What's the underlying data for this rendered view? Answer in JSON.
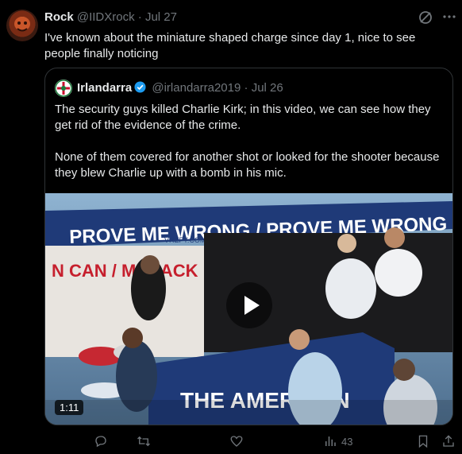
{
  "tweet": {
    "author_name": "Rock",
    "author_handle": "@IIDXrock",
    "separator": "·",
    "date": "Jul 27",
    "text": "I've known about the miniature shaped charge since day 1, nice to see people finally noticing"
  },
  "quote": {
    "author_name": "Irlandarra",
    "author_handle": "@irlandarra2019",
    "separator": "·",
    "date": "Jul 26",
    "paragraph1": "The security guys  killed Charlie Kirk; in this video, we can see how they get rid of the evidence of the crime.",
    "paragraph2": "None of them covered for another shot or looked for the shooter because they blew Charlie up with a bomb in his mic.",
    "video": {
      "banner_text": "PROVE ME WRONG / PROVE ME WRONG",
      "left_sign": "N CAN / MEBACK",
      "site_text": "VREFY.COM",
      "table_sign": "THE AMERICAN",
      "duration": "1:11"
    }
  },
  "actions": {
    "views_count": "43"
  },
  "colors": {
    "background": "#000000",
    "text": "#e7e9ea",
    "muted": "#71767b",
    "verified": "#1d9bf0"
  },
  "icons": [
    "grok-icon",
    "more-icon",
    "verified-icon",
    "play-icon",
    "reply-icon",
    "retweet-icon",
    "like-icon",
    "views-icon",
    "bookmark-icon",
    "share-icon"
  ]
}
